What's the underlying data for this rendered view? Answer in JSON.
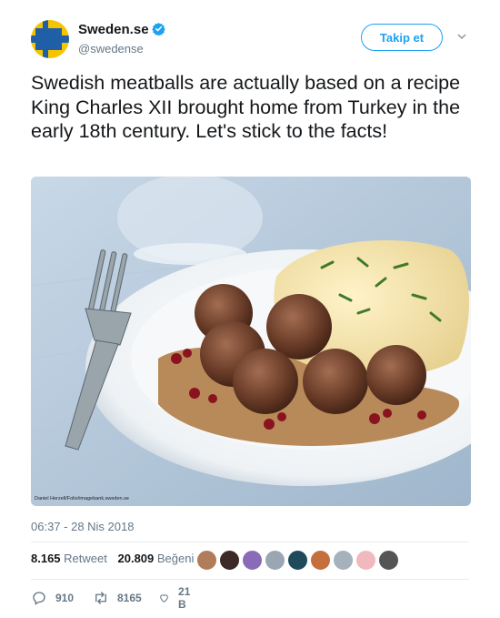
{
  "account": {
    "display_name": "Sweden.se",
    "handle": "@swedense",
    "verified": true,
    "follow_label": "Takip et"
  },
  "tweet": {
    "text": "Swedish meatballs are actually based on a recipe King Charles XII brought home from Turkey in the early 18th century. Let's stick to the facts!",
    "image_credit": "Daniel Herzell/Folio/imagebank.sweden.se",
    "timestamp": "06:37 - 28 Nis 2018"
  },
  "stats": {
    "retweet_count": "8.165",
    "retweet_label": "Retweet",
    "like_count": "20.809",
    "like_label": "Beğeni"
  },
  "actions": {
    "reply_count": "910",
    "retweet_count": "8165",
    "like_count": "21 B"
  },
  "colors": {
    "accent": "#1da1f2",
    "flag_blue": "#1f5fa8",
    "flag_yellow": "#f5c400",
    "muted": "#657786"
  }
}
